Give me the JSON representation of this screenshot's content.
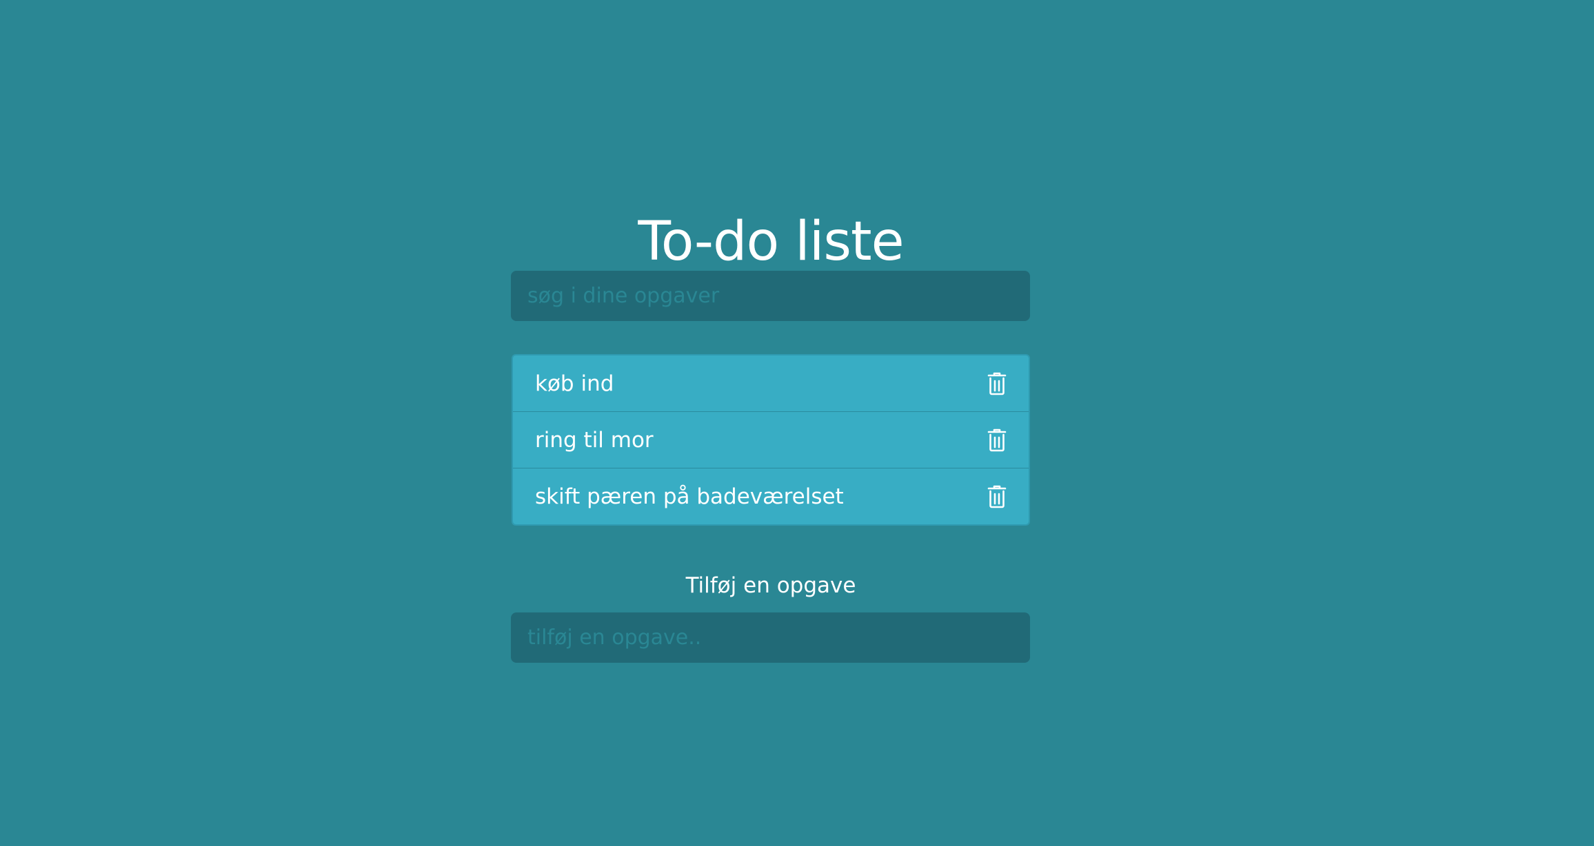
{
  "page": {
    "title": "To-do liste",
    "background_color": "#2a8794"
  },
  "search": {
    "placeholder": "søg i dine opgaver",
    "value": ""
  },
  "todos": [
    {
      "text": "køb ind",
      "action_icon": "trash-icon"
    },
    {
      "text": "ring til mor",
      "action_icon": "trash-icon"
    },
    {
      "text": "skift pæren på badeværelset",
      "action_icon": "trash-icon"
    }
  ],
  "add": {
    "label": "Tilføj en opgave",
    "placeholder": "tilføj en opgave..",
    "value": ""
  },
  "colors": {
    "input_bg": "#216a77",
    "item_bg": "#38adc4",
    "text": "#ffffff"
  }
}
